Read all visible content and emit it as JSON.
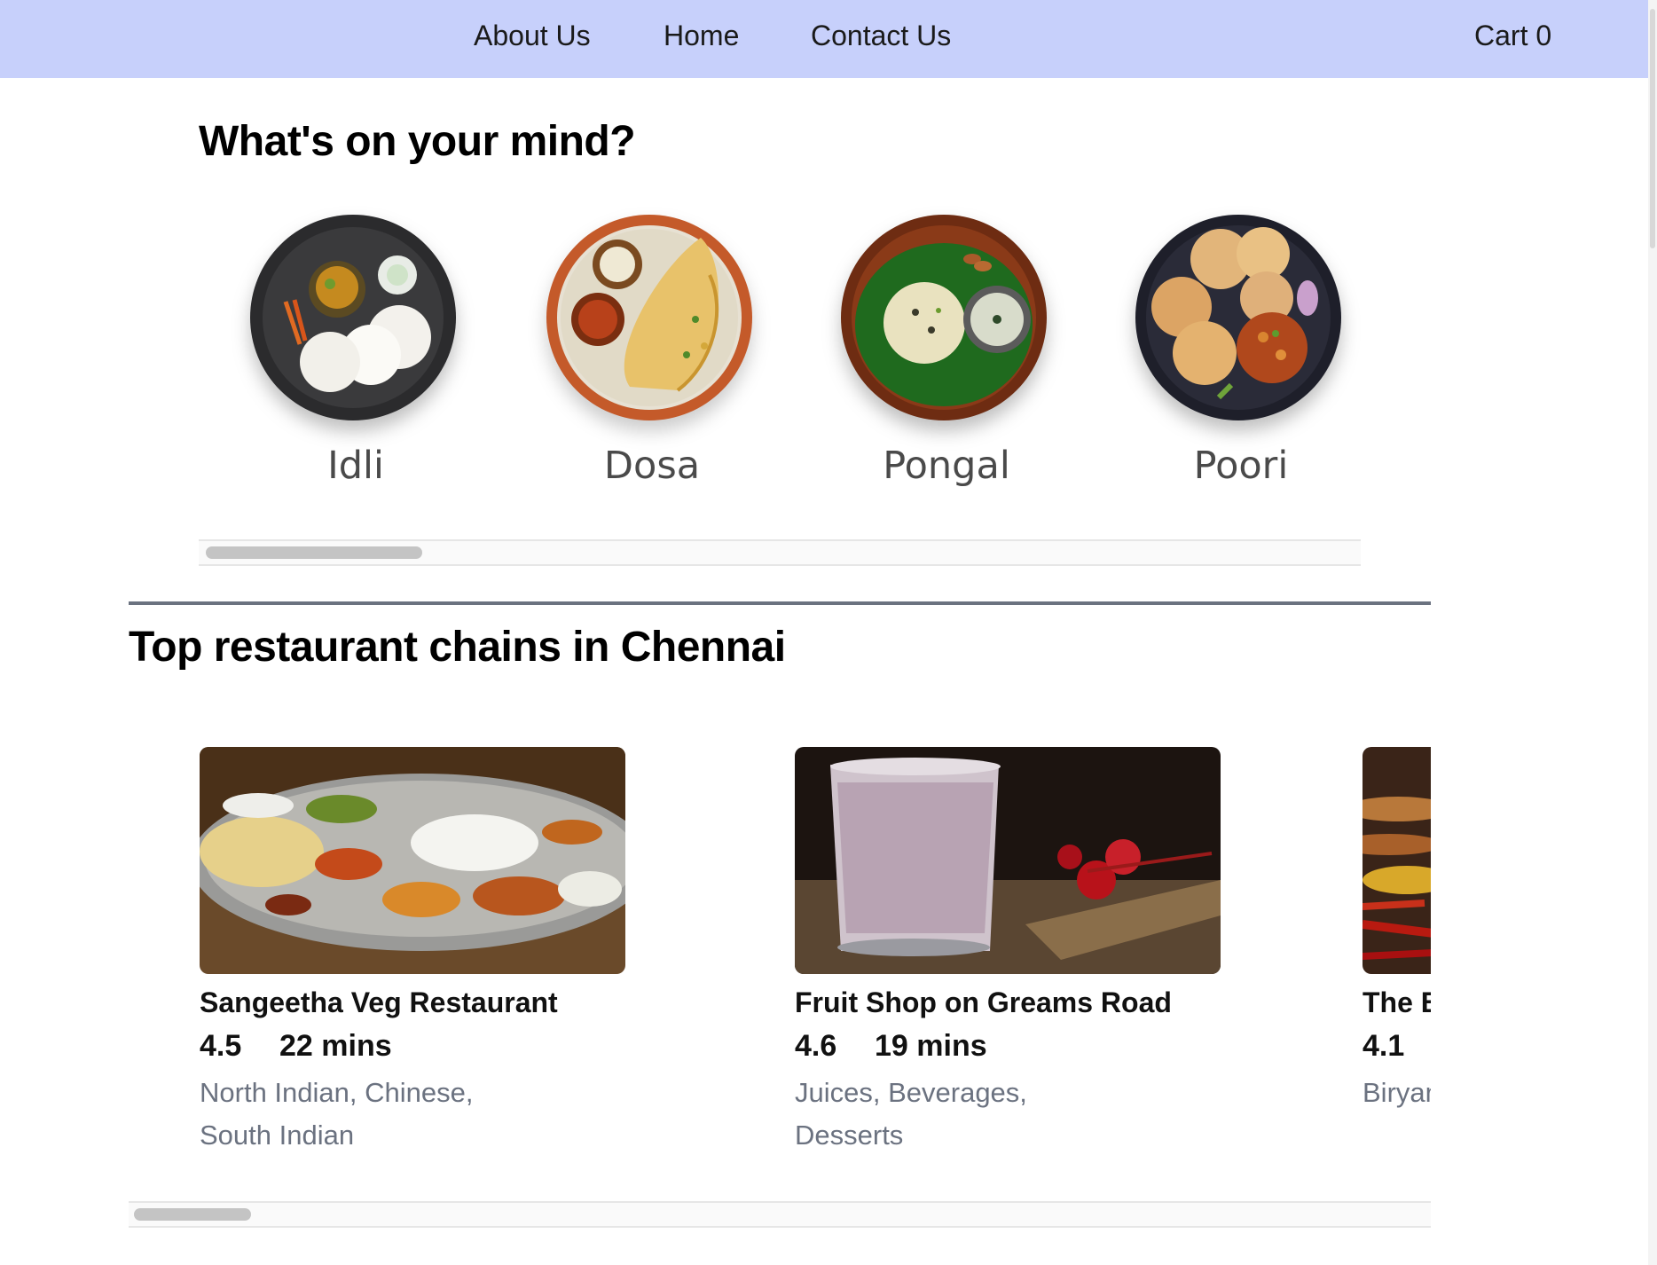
{
  "nav": {
    "links": [
      "About Us",
      "Home",
      "Contact Us"
    ],
    "cart_label": "Cart",
    "cart_count": "0",
    "background": "#c7d0fb"
  },
  "mind_section": {
    "title": "What's on your mind?",
    "categories": [
      {
        "label": "Idli",
        "icon": "idli-plate-image"
      },
      {
        "label": "Dosa",
        "icon": "dosa-plate-image"
      },
      {
        "label": "Pongal",
        "icon": "pongal-plate-image"
      },
      {
        "label": "Poori",
        "icon": "poori-plate-image"
      }
    ]
  },
  "restaurants_section": {
    "title": "Top restaurant chains in Chennai",
    "cards": [
      {
        "name": "Sangeetha Veg Restaurant",
        "rating": "4.5",
        "time": "22 mins",
        "cuisine_line1": "North Indian, Chinese,",
        "cuisine_line2": "South Indian",
        "image": "thali-image"
      },
      {
        "name": "Fruit Shop on Greams Road",
        "rating": "4.6",
        "time": "19 mins",
        "cuisine_line1": "Juices, Beverages,",
        "cuisine_line2": "Desserts",
        "image": "milkshake-image"
      },
      {
        "name": "The B",
        "rating": "4.1",
        "time": "",
        "cuisine_line1": "Biryan",
        "cuisine_line2": "",
        "image": "spices-image"
      }
    ]
  },
  "colors": {
    "muted_text": "#6b7280",
    "divider": "#6b7280"
  }
}
